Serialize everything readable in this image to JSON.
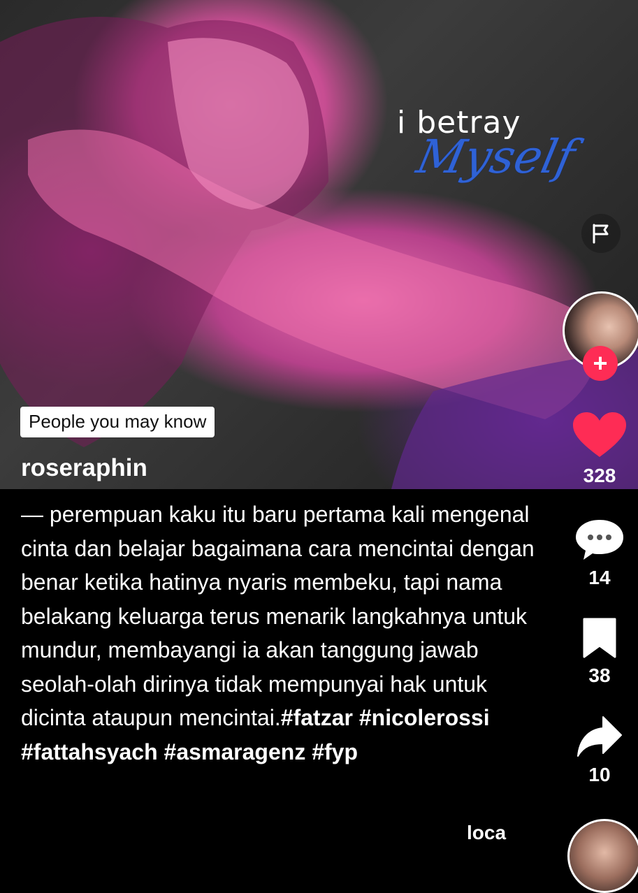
{
  "video": {
    "overlay_line1": "i betray",
    "overlay_line2": "Myself",
    "people_badge": "People you may know"
  },
  "post": {
    "username": "roseraphin",
    "caption": "— perempuan kaku itu baru pertama kali mengenal cinta dan belajar bagaimana cara mencintai dengan benar ketika hatinya nyaris membeku, tapi nama belakang keluarga terus menarik langkahnya untuk mundur, membayangi ia akan tanggung jawab seolah-olah dirinya tidak mempunyai hak untuk dicinta ataupun mencintai.",
    "hashtags": "#fatzar #nicolerossi #fattahsyach #asmaragenz #fyp",
    "partial_text": "loca"
  },
  "actions": {
    "report_icon": "flag-icon",
    "follow_label": "+",
    "like_count": "328",
    "comment_count": "14",
    "bookmark_count": "38",
    "share_count": "10"
  },
  "colors": {
    "like": "#fe2c55",
    "follow": "#fe2c55",
    "overlay_script": "#2f62d6"
  }
}
